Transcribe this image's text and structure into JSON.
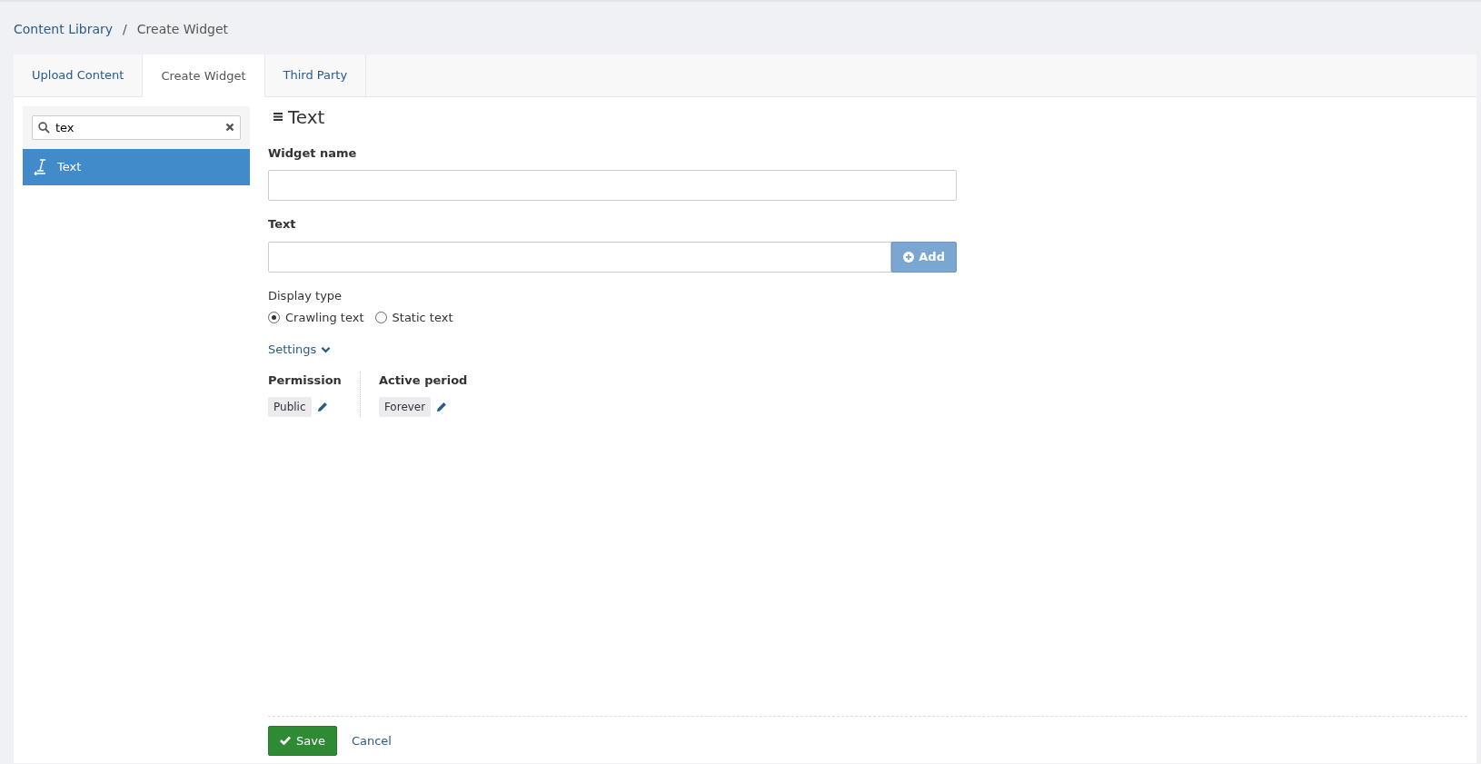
{
  "breadcrumb": {
    "separator": "/",
    "items": [
      {
        "label": "Content Library",
        "link": true
      },
      {
        "label": "Create Widget",
        "link": false
      }
    ]
  },
  "tabs": [
    {
      "label": "Upload Content",
      "selected": false
    },
    {
      "label": "Create Widget",
      "selected": true
    },
    {
      "label": "Third Party",
      "selected": false
    }
  ],
  "sidebar": {
    "search": {
      "value": "tex"
    },
    "items": [
      {
        "label": "Text",
        "selected": true
      }
    ]
  },
  "form": {
    "title": "Text",
    "widget_name": {
      "label": "Widget name"
    },
    "text": {
      "label": "Text",
      "button": "Add"
    },
    "display_type": {
      "label": "Display type",
      "options": [
        {
          "label": "Crawling text",
          "selected": true
        },
        {
          "label": "Static text",
          "selected": false
        }
      ]
    },
    "settings": {
      "label": "Settings",
      "expanded": true
    },
    "properties": [
      {
        "label": "Permission",
        "value": "Public"
      },
      {
        "label": "Active period",
        "value": "Forever"
      }
    ]
  },
  "footer": {
    "save": "Save",
    "cancel": "Cancel"
  }
}
